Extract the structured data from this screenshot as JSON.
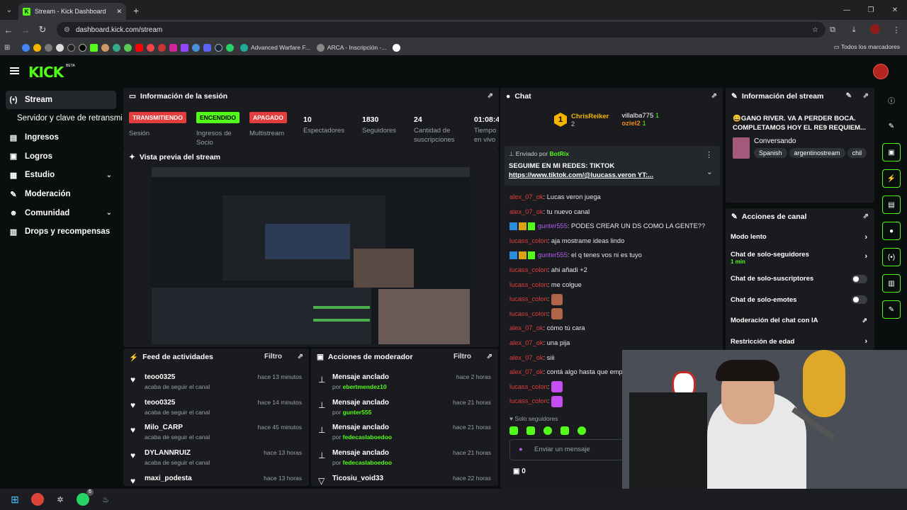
{
  "browser": {
    "tab_title": "Stream - Kick Dashboard",
    "url": "dashboard.kick.com/stream",
    "bookmarks": [
      {
        "label": "Advanced Warfare F..."
      },
      {
        "label": "ARCA - Inscripción -..."
      }
    ],
    "all_bookmarks": "Todos los marcadores"
  },
  "header": {
    "logo": "KICK",
    "beta": "BETA"
  },
  "sidebar": {
    "items": [
      {
        "label": "Stream",
        "icon": "broadcast-icon"
      },
      {
        "label": "Servidor y clave de retransmisión"
      },
      {
        "label": "Ingresos",
        "icon": "wallet-icon"
      },
      {
        "label": "Logros",
        "icon": "trophy-icon"
      },
      {
        "label": "Estudio",
        "icon": "layout-icon"
      },
      {
        "label": "Moderación",
        "icon": "wrench-icon"
      },
      {
        "label": "Comunidad",
        "icon": "users-icon"
      },
      {
        "label": "Drops y recompensas",
        "icon": "gift-icon"
      }
    ]
  },
  "session": {
    "title": "Información de la sesión",
    "cols": [
      {
        "badge": "TRANSMITIENDO",
        "badge_color": "#e33d3d",
        "label": "Sesión"
      },
      {
        "badge": "ENCENDIDO",
        "badge_color": "#53fc18",
        "label": "Ingresos de Socio"
      },
      {
        "badge": "APAGADO",
        "badge_color": "#e33d3d",
        "label": "Multistream"
      },
      {
        "value": "10",
        "label": "Espectadores"
      },
      {
        "value": "1830",
        "label": "Seguidores"
      },
      {
        "value": "24",
        "label": "Cantidad de suscripciones"
      },
      {
        "value": "01:08:4",
        "label": "Tiempo en vivo"
      }
    ]
  },
  "preview": {
    "title": "Vista previa del stream"
  },
  "feed": {
    "title": "Feed de actividades",
    "filter": "Filtro",
    "items": [
      {
        "name": "teoo0325",
        "sub": "acaba de seguir el canal",
        "time": "hace 13 minutos"
      },
      {
        "name": "teoo0325",
        "sub": "acaba de seguir el canal",
        "time": "hace 14 minutos"
      },
      {
        "name": "Milo_CARP",
        "sub": "acaba de seguir el canal",
        "time": "hace 45 minutos"
      },
      {
        "name": "DYLANNRUIZ",
        "sub": "acaba de seguir el canal",
        "time": "hace 13 horas"
      },
      {
        "name": "maxi_podesta",
        "sub": "",
        "time": "hace 13 horas"
      }
    ]
  },
  "mod": {
    "title": "Acciones de moderador",
    "filter": "Filtro",
    "items": [
      {
        "name": "Mensaje anclado",
        "by": "por",
        "user": "ebertmendez10",
        "time": "hace 2 horas"
      },
      {
        "name": "Mensaje anclado",
        "by": "por",
        "user": "gunter555",
        "time": "hace 21 horas"
      },
      {
        "name": "Mensaje anclado",
        "by": "por",
        "user": "fedecaslaboedoo",
        "time": "hace 21 horas"
      },
      {
        "name": "Mensaje anclado",
        "by": "por",
        "user": "fedecaslaboedoo",
        "time": "hace 21 horas"
      },
      {
        "name": "Ticosiu_void33",
        "by": "",
        "user": "",
        "time": "hace 22 horas"
      }
    ]
  },
  "chat": {
    "title": "Chat",
    "top": [
      {
        "rank": "1",
        "name": "ChrisReiker",
        "count": "2"
      },
      {
        "name": "villalba775",
        "count": "1"
      },
      {
        "name": "oziel2",
        "count": "1"
      }
    ],
    "pinned": {
      "label": "Enviado por",
      "user": "BotRix",
      "line1": "SEGUIME EN MI REDES: TIKTOK",
      "line2": "https://www.tiktok.com/@luucass.veron YT:..."
    },
    "messages": [
      {
        "user": "alex_07_ok",
        "color": "red",
        "text": "Lucas veron juega"
      },
      {
        "user": "alex_07_ok",
        "color": "red",
        "text": "tu nuevo canal"
      },
      {
        "user": "gunter555",
        "color": "purple",
        "text": "PODES CREAR UN DS COMO LA GENTE??"
      },
      {
        "user": "lucass_colon",
        "color": "red",
        "text": "aja mostrame ideas lindo"
      },
      {
        "user": "gunter555",
        "color": "purple",
        "text": "el q tenes vos ni es tuyo"
      },
      {
        "user": "lucass_colon",
        "color": "red",
        "text": "ahi añadi +2"
      },
      {
        "user": "lucass_colon",
        "color": "red",
        "text": "me colgue"
      },
      {
        "user": "lucass_colon",
        "color": "red",
        "text": ""
      },
      {
        "user": "lucass_colon",
        "color": "red",
        "text": ""
      },
      {
        "user": "alex_07_ok",
        "color": "red",
        "text": "cómo tú cara"
      },
      {
        "user": "alex_07_ok",
        "color": "red",
        "text": "una pija"
      },
      {
        "user": "alex_07_ok",
        "color": "red",
        "text": "siii"
      },
      {
        "user": "alex_07_ok",
        "color": "red",
        "text": "contá algo hasta que empie"
      },
      {
        "user": "lucass_colon",
        "color": "red",
        "text": ""
      },
      {
        "user": "lucass_colon",
        "color": "red",
        "text": ""
      }
    ],
    "mode": "Solo seguidores",
    "input_placeholder": "Enviar un mensaje",
    "points": "0"
  },
  "stream_info": {
    "title": "Información del stream",
    "stream_title": "😀GANO RIVER. VA A PERDER BOCA. COMPLETAMOS HOY EL RE9 REQUIEM...",
    "category": "Conversando",
    "tags": [
      "Spanish",
      "argentinostream",
      "chil"
    ]
  },
  "actions": {
    "title": "Acciones de canal",
    "items": [
      {
        "label": "Modo lento",
        "type": "arrow"
      },
      {
        "label": "Chat de solo-seguidores",
        "sub": "1 min",
        "type": "arrow"
      },
      {
        "label": "Chat de solo-suscriptores",
        "type": "toggle"
      },
      {
        "label": "Chat de solo-emotes",
        "type": "toggle"
      },
      {
        "label": "Moderación del chat con IA",
        "type": "link"
      },
      {
        "label": "Restricción de edad",
        "type": "arrow"
      }
    ]
  },
  "taskbar": {
    "notif": "6"
  }
}
